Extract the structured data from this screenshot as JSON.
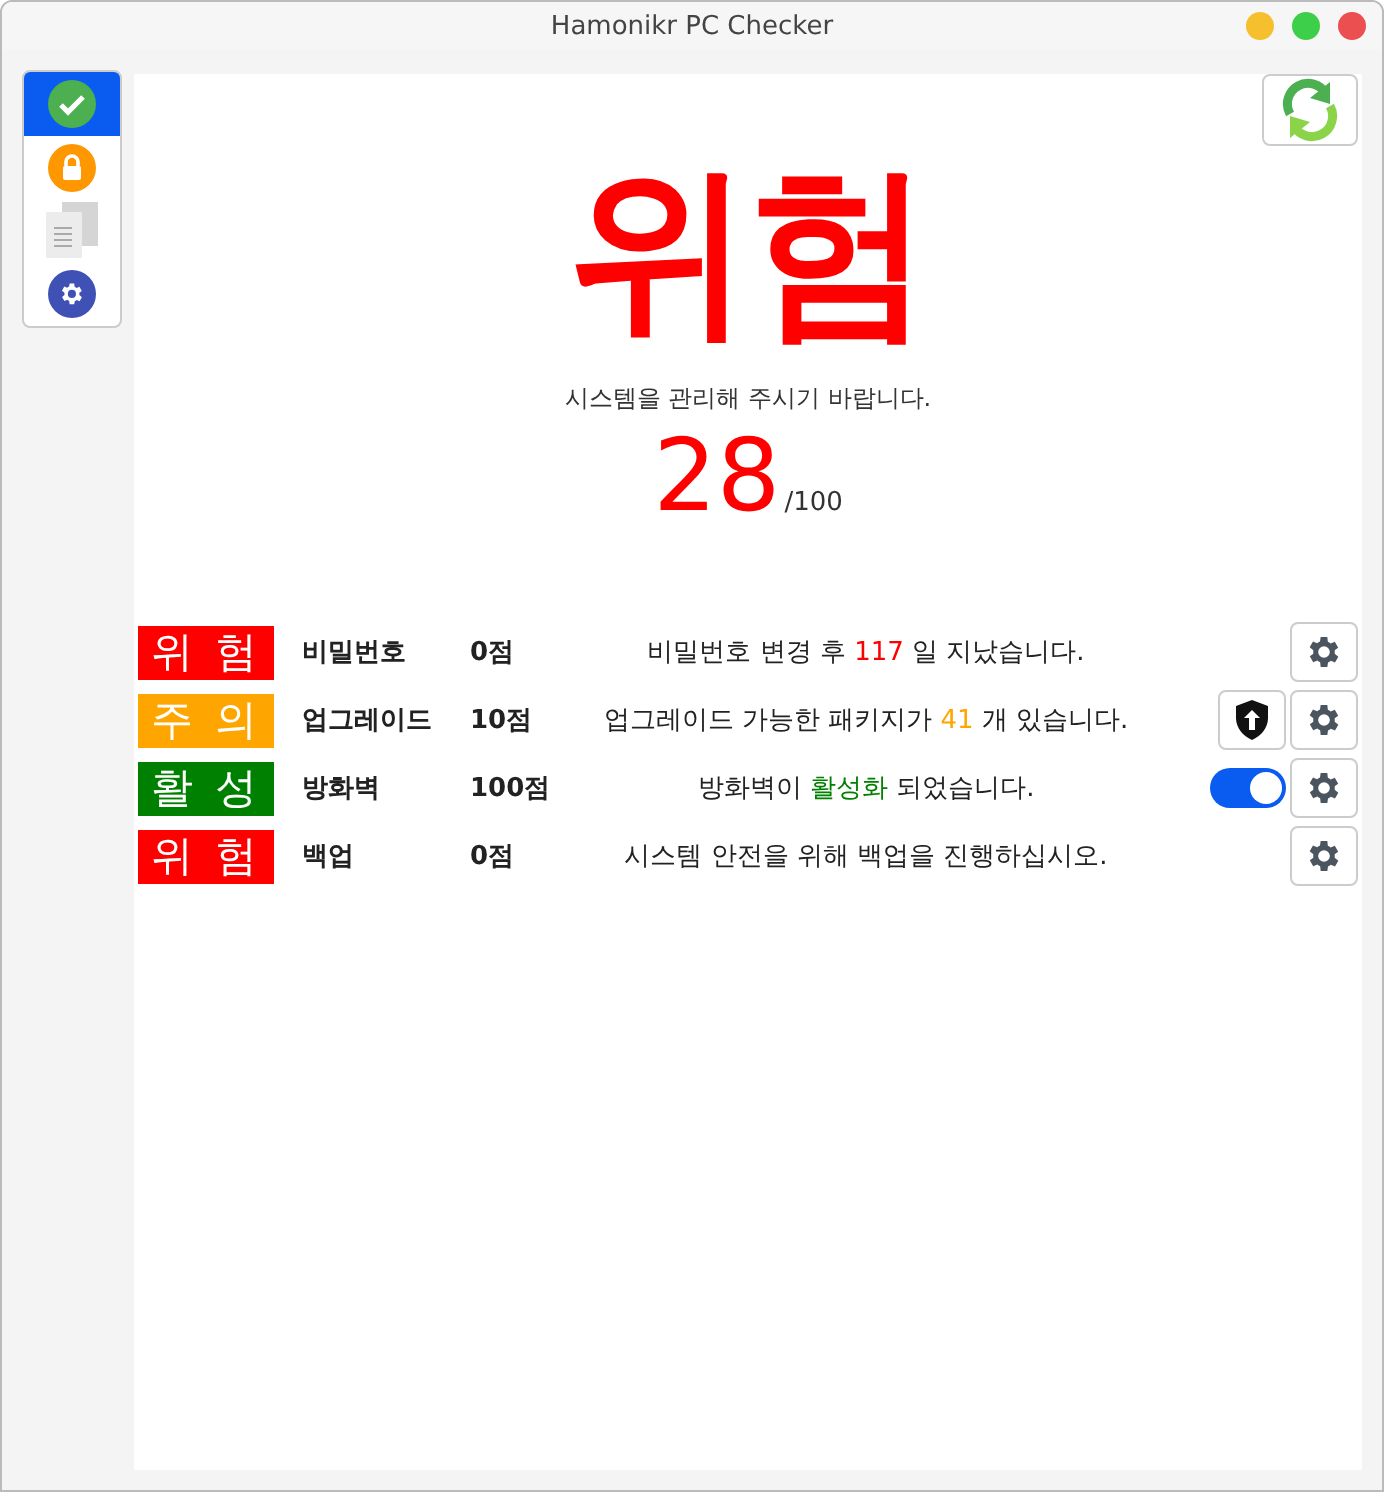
{
  "window": {
    "title": "Hamonikr PC Checker"
  },
  "sidebar": {
    "items": [
      {
        "kind": "check",
        "selected": true
      },
      {
        "kind": "lock",
        "selected": false
      },
      {
        "kind": "document",
        "selected": false
      },
      {
        "kind": "settings",
        "selected": false
      }
    ]
  },
  "summary": {
    "status": "위험",
    "message": "시스템을 관리해 주시기 바랍니다.",
    "score": "28",
    "score_max": "/100"
  },
  "checks": [
    {
      "color": "#ff0000",
      "badge": "위 험",
      "name": "비밀번호",
      "score": "0점",
      "message_before": "비밀번호 변경 후 ",
      "message_value": "117",
      "message_after": " 일 지났습니다.",
      "kind": "plain"
    },
    {
      "color": "#ffa500",
      "badge": "주 의",
      "name": "업그레이드",
      "score": "10점",
      "message_before": "업그레이드 가능한 패키지가 ",
      "message_value": "41",
      "message_after": " 개 있습니다.",
      "kind": "upgrade"
    },
    {
      "color": "#008000",
      "badge": "활 성",
      "name": "방화벽",
      "score": "100점",
      "message_before": "방화벽이 ",
      "message_value": "활성화",
      "message_after": " 되었습니다.",
      "kind": "toggle",
      "on": true
    },
    {
      "color": "#ff0000",
      "badge": "위 험",
      "name": "백업",
      "score": "0점",
      "message_before": "시스템 안전을 위해 백업을 진행하십시오.",
      "kind": "plain"
    }
  ]
}
